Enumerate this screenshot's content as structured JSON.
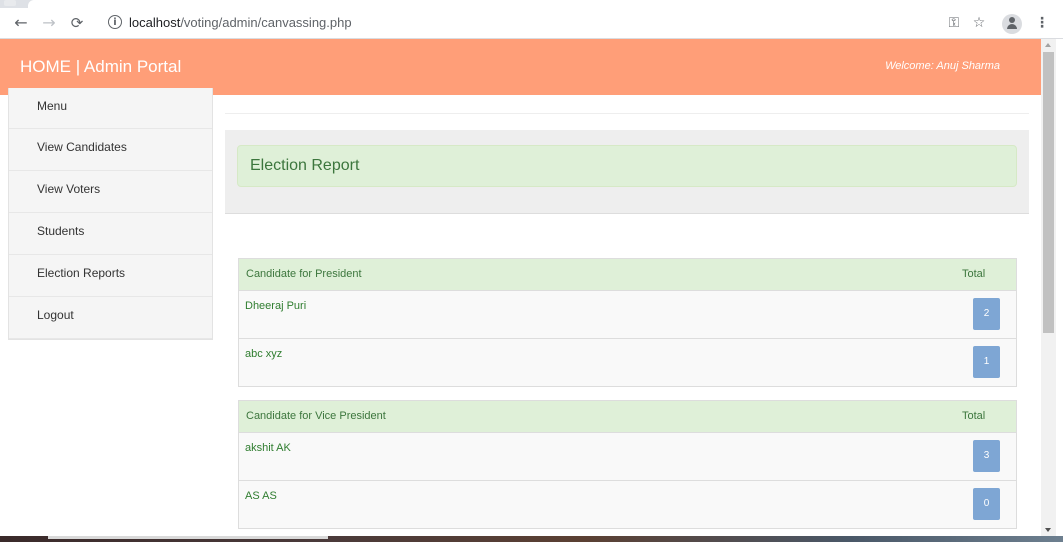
{
  "browser": {
    "url_host": "localhost",
    "url_path": "/voting/admin/canvassing.php"
  },
  "header": {
    "brand": "HOME | Admin Portal",
    "welcome": "Welcome: Anuj Sharma"
  },
  "sidebar": {
    "items": [
      {
        "label": "Menu"
      },
      {
        "label": "View Candidates"
      },
      {
        "label": "View Voters"
      },
      {
        "label": "Students"
      },
      {
        "label": "Election Reports"
      },
      {
        "label": "Logout"
      }
    ]
  },
  "report": {
    "title": "Election Report"
  },
  "tables": [
    {
      "header": "Candidate for President",
      "total_label": "Total",
      "rows": [
        {
          "name": "Dheeraj Puri",
          "total": "2"
        },
        {
          "name": "abc xyz",
          "total": "1"
        }
      ]
    },
    {
      "header": "Candidate for Vice President",
      "total_label": "Total",
      "rows": [
        {
          "name": "akshit AK",
          "total": "3"
        },
        {
          "name": "AS AS",
          "total": "0"
        }
      ]
    }
  ],
  "colors": {
    "header_bg": "#ff9e78",
    "success_bg": "#dff0d8",
    "success_text": "#3c763d",
    "badge_bg": "#7ea6d4"
  },
  "icons": [
    "back-arrow-icon",
    "forward-arrow-icon",
    "reload-icon",
    "info-icon",
    "key-icon",
    "star-icon",
    "profile-icon",
    "more-vert-icon"
  ]
}
